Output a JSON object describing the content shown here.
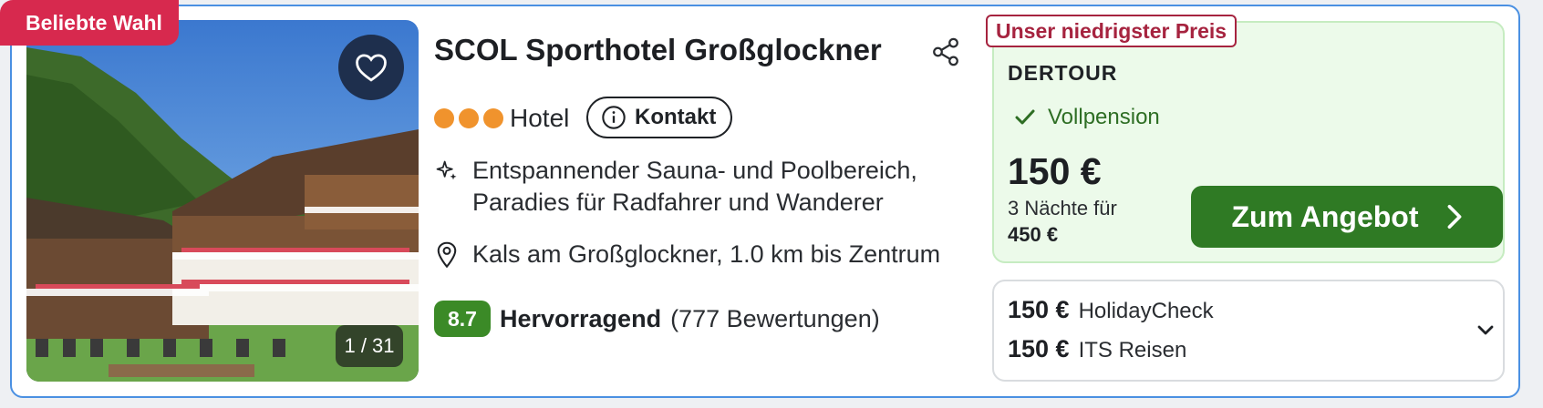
{
  "badge": "Beliebte Wahl",
  "gallery": {
    "counter": "1 / 31"
  },
  "hotel": {
    "name": "SCOL Sporthotel Großglockner",
    "stars": 3,
    "type": "Hotel",
    "contact_label": "Kontakt",
    "feature": "Entspannender Sauna- und Poolbereich, Paradies für Radfahrer und Wanderer",
    "location": "Kals am Großglockner, 1.0 km bis Zentrum",
    "rating": {
      "score": "8.7",
      "label": "Hervorragend",
      "count": "(777 Bewertungen)"
    }
  },
  "offer": {
    "badge": "Unser niedrigster Preis",
    "provider": "DERTOUR",
    "board": "Vollpension",
    "price": "150 €",
    "nights": "3 Nächte für",
    "total": "450 €",
    "cta": "Zum Angebot"
  },
  "other_offers": [
    {
      "price": "150 €",
      "provider": "HolidayCheck"
    },
    {
      "price": "150 €",
      "provider": "ITS Reisen"
    }
  ],
  "colors": {
    "accent_border": "#4a90e2",
    "popular_badge": "#d7294e",
    "star_dot": "#f0932d",
    "rating_bg": "#3b8a27",
    "cta_bg": "#2f7a24",
    "lowest_badge": "#a6233f"
  },
  "icons": {
    "favorite": "heart-outline-icon",
    "share": "share-icon",
    "info": "info-circle-icon",
    "feature": "sparkle-icon",
    "location": "map-pin-icon",
    "board": "checkmark-icon",
    "cta_arrow": "chevron-right-icon",
    "expand": "chevron-down-icon"
  }
}
